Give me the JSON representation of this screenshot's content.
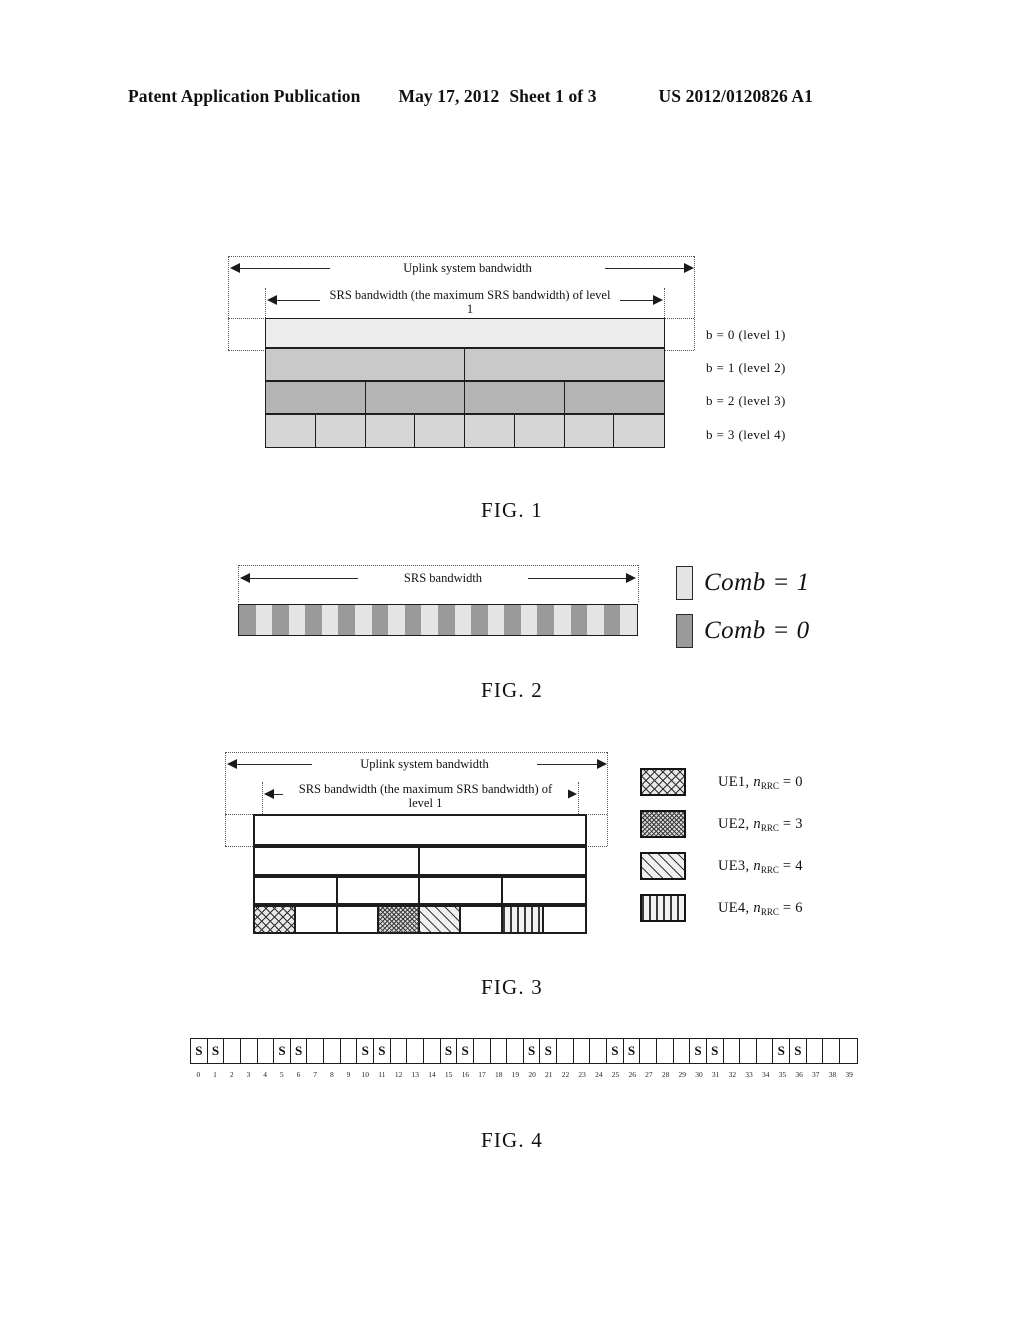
{
  "header": {
    "publication": "Patent Application Publication",
    "date": "May 17, 2012",
    "sheet": "Sheet 1 of 3",
    "docnum": "US 2012/0120826 A1"
  },
  "figures": [
    {
      "caption": "FIG. 1",
      "uplink_label": "Uplink system bandwidth",
      "srs_label": "SRS bandwidth (the maximum SRS bandwidth) of level 1",
      "rows": [
        {
          "cells": 1,
          "shade": "sh0"
        },
        {
          "cells": 2,
          "shade": "sh1"
        },
        {
          "cells": 4,
          "shade": "sh2"
        },
        {
          "cells": 8,
          "shade": "sh3"
        }
      ],
      "level_labels": [
        {
          "b": "b  =  0",
          "level": "(level 1)"
        },
        {
          "b": "b  =  1",
          "level": "(level 2)"
        },
        {
          "b": "b  =  2",
          "level": "(level 3)"
        },
        {
          "b": "b  =  3",
          "level": "(level 4)"
        }
      ]
    },
    {
      "caption": "FIG. 2",
      "srs_label": "SRS bandwidth",
      "comb_cells": 24,
      "legend": [
        {
          "swatch": "comb-off",
          "text": "Comb = 1"
        },
        {
          "swatch": "comb-on",
          "text": "Comb = 0"
        }
      ]
    },
    {
      "caption": "FIG. 3",
      "uplink_label": "Uplink system bandwidth",
      "srs_label": "SRS bandwidth (the maximum SRS bandwidth) of level 1",
      "rows": [
        {
          "cells": 1
        },
        {
          "cells": 2
        },
        {
          "cells": 4
        },
        {
          "cells": 8
        }
      ],
      "bottom_fills": [
        "hatch-cross",
        "shw",
        "shw",
        "hatch-dense",
        "hatch-diag",
        "shw",
        "hatch-vert",
        "shw"
      ],
      "legend": [
        {
          "fill": "hatch-cross",
          "ue": "UE1,",
          "nvar": "n",
          "sub": "RRC",
          "eq": "= 0"
        },
        {
          "fill": "hatch-dense",
          "ue": "UE2,",
          "nvar": "n",
          "sub": "RRC",
          "eq": "= 3"
        },
        {
          "fill": "hatch-diag",
          "ue": "UE3,",
          "nvar": "n",
          "sub": "RRC",
          "eq": "= 4"
        },
        {
          "fill": "hatch-vert",
          "ue": "UE4,",
          "nvar": "n",
          "sub": "RRC",
          "eq": "= 6"
        }
      ]
    },
    {
      "caption": "FIG. 4",
      "subframe_count": 40,
      "srs_marker": "S",
      "srs_positions": [
        0,
        1,
        5,
        6,
        10,
        11,
        15,
        16,
        20,
        21,
        25,
        26,
        30,
        31,
        35,
        36
      ],
      "indices": [
        0,
        1,
        2,
        3,
        4,
        5,
        6,
        7,
        8,
        9,
        10,
        11,
        12,
        13,
        14,
        15,
        16,
        17,
        18,
        19,
        20,
        21,
        22,
        23,
        24,
        25,
        26,
        27,
        28,
        29,
        30,
        31,
        32,
        33,
        34,
        35,
        36,
        37,
        38,
        39
      ]
    }
  ]
}
